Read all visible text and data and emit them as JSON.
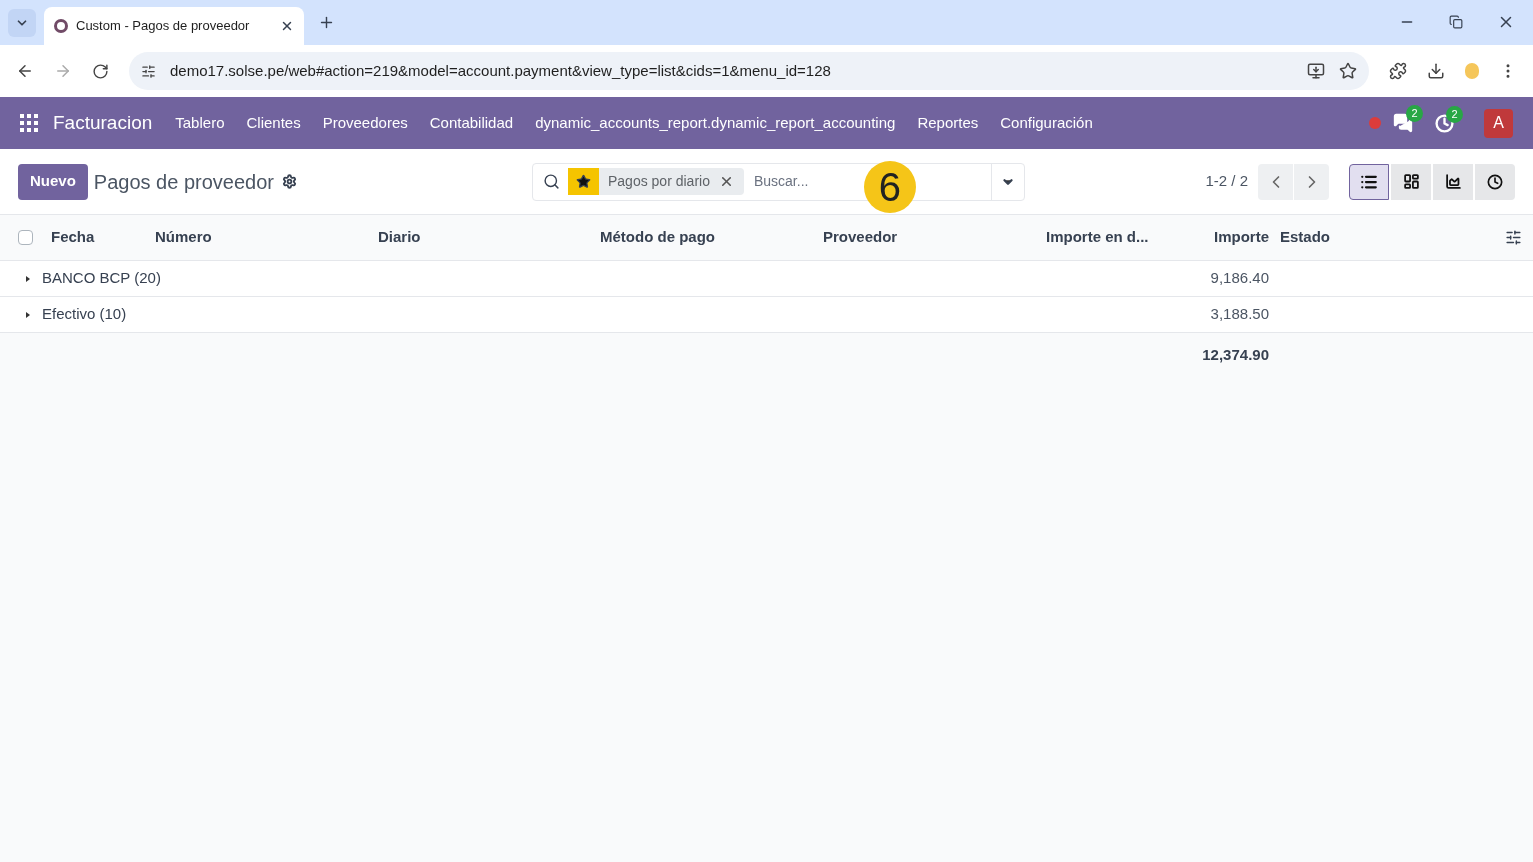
{
  "browser": {
    "tabs": [
      {
        "title": "Custom - Pagos de proveedor",
        "selected": true
      }
    ],
    "url": "demo17.solse.pe/web#action=219&model=account.payment&view_type=list&cids=1&menu_id=128"
  },
  "navbar": {
    "app": "Facturacion",
    "menu": [
      "Tablero",
      "Clientes",
      "Proveedores",
      "Contabilidad",
      "dynamic_accounts_report.dynamic_report_accounting",
      "Reportes",
      "Configuración"
    ],
    "messages_badge": "2",
    "activities_badge": "2",
    "avatar": "A"
  },
  "control_panel": {
    "new_button": "Nuevo",
    "title": "Pagos de proveedor",
    "facet": "Pagos por diario",
    "search_placeholder": "Buscar...",
    "step_marker": "6",
    "pager": "1-2 / 2",
    "views": [
      {
        "kind": "list",
        "selected": true
      },
      {
        "kind": "kanban",
        "selected": false
      },
      {
        "kind": "graph",
        "selected": false
      },
      {
        "kind": "activity",
        "selected": false
      }
    ]
  },
  "table": {
    "select_all_checked": false,
    "columns": [
      "Fecha",
      "Número",
      "Diario",
      "Método de pago",
      "Proveedor",
      "Importe en d...",
      "Importe",
      "Estado"
    ],
    "groups": [
      {
        "label": "BANCO BCP (20)",
        "expanded": false,
        "amount": "9,186.40"
      },
      {
        "label": "Efectivo (10)",
        "expanded": false,
        "amount": "3,188.50"
      }
    ],
    "total": "12,374.90"
  }
}
